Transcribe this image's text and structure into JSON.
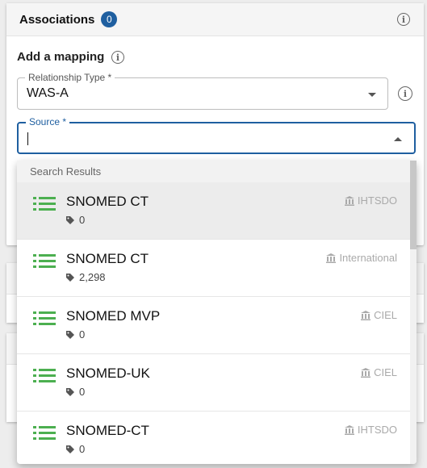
{
  "panel": {
    "title": "Associations",
    "count": "0"
  },
  "mapping": {
    "section_title": "Add a mapping",
    "relationship_type": {
      "label": "Relationship Type *",
      "value": "WAS-A"
    },
    "source": {
      "label": "Source *",
      "value": ""
    }
  },
  "dropdown": {
    "header": "Search Results",
    "results": [
      {
        "name": "SNOMED CT",
        "count": "0",
        "org": "IHTSDO"
      },
      {
        "name": "SNOMED CT",
        "count": "2,298",
        "org": "International"
      },
      {
        "name": "SNOMED MVP",
        "count": "0",
        "org": "CIEL"
      },
      {
        "name": "SNOMED-UK",
        "count": "0",
        "org": "CIEL"
      },
      {
        "name": "SNOMED-CT",
        "count": "0",
        "org": "IHTSDO"
      }
    ]
  },
  "colors": {
    "accent": "#1f5fa0",
    "list_icon": "#4caf50",
    "badge": "#1f5fa0"
  },
  "icons": {
    "info": "info-circle-icon",
    "list": "list-icon",
    "tag": "tag-icon",
    "org": "bank-icon"
  }
}
